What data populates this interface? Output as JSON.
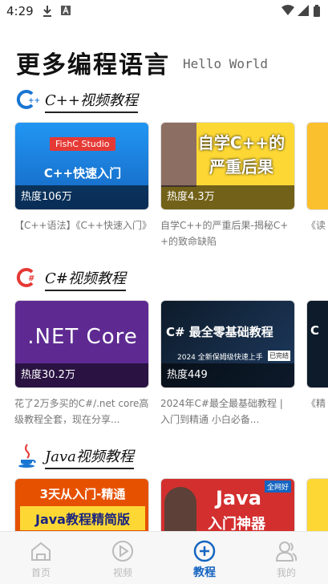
{
  "status_bar": {
    "time": "4:29"
  },
  "header": {
    "title": "更多编程语言",
    "subtitle": "Hello World"
  },
  "sections": [
    {
      "title": "C++视频教程",
      "cards": [
        {
          "thumb_badge": "FishC Studio",
          "thumb_text": "C++快速入门",
          "heat": "热度106万",
          "desc": "【C++语法】《C++快速入门》"
        },
        {
          "thumb_text": "自学C++的严重后果",
          "heat": "热度4.3万",
          "desc": "自学C++的严重后果-揭秘C++的致命缺陷"
        },
        {
          "desc": "《读"
        }
      ]
    },
    {
      "title": "C#视频教程",
      "cards": [
        {
          "thumb_text": ".NET Core",
          "heat": "热度30.2万",
          "desc": "花了2万多买的C#/.net core高级教程全套，现在分享..."
        },
        {
          "thumb_text": "C# 最全零基础教程",
          "thumb_sub": "2024 全新保姆级快速上手",
          "thumb_tag": "已完结",
          "heat": "热度449",
          "desc": "2024年C#最全最基础教程 | 入门到精通 小白必备..."
        },
        {
          "thumb_text": "C",
          "desc": "《精"
        }
      ]
    },
    {
      "title": "Java视频教程",
      "cards": [
        {
          "thumb_text": "3天从入门-精通",
          "thumb_sub": "Java教程精简版"
        },
        {
          "thumb_tag": "全网好",
          "thumb_text": "Java",
          "thumb_sub": "入门神器"
        },
        {}
      ]
    }
  ],
  "tabbar": {
    "items": [
      {
        "label": "首页",
        "icon": "home-icon",
        "active": false
      },
      {
        "label": "视频",
        "icon": "play-icon",
        "active": false
      },
      {
        "label": "教程",
        "icon": "plus-circle-icon",
        "active": true
      },
      {
        "label": "我的",
        "icon": "user-icon",
        "active": false
      }
    ]
  },
  "colors": {
    "accent": "#1565c0",
    "inactive": "#bbbbbb"
  }
}
